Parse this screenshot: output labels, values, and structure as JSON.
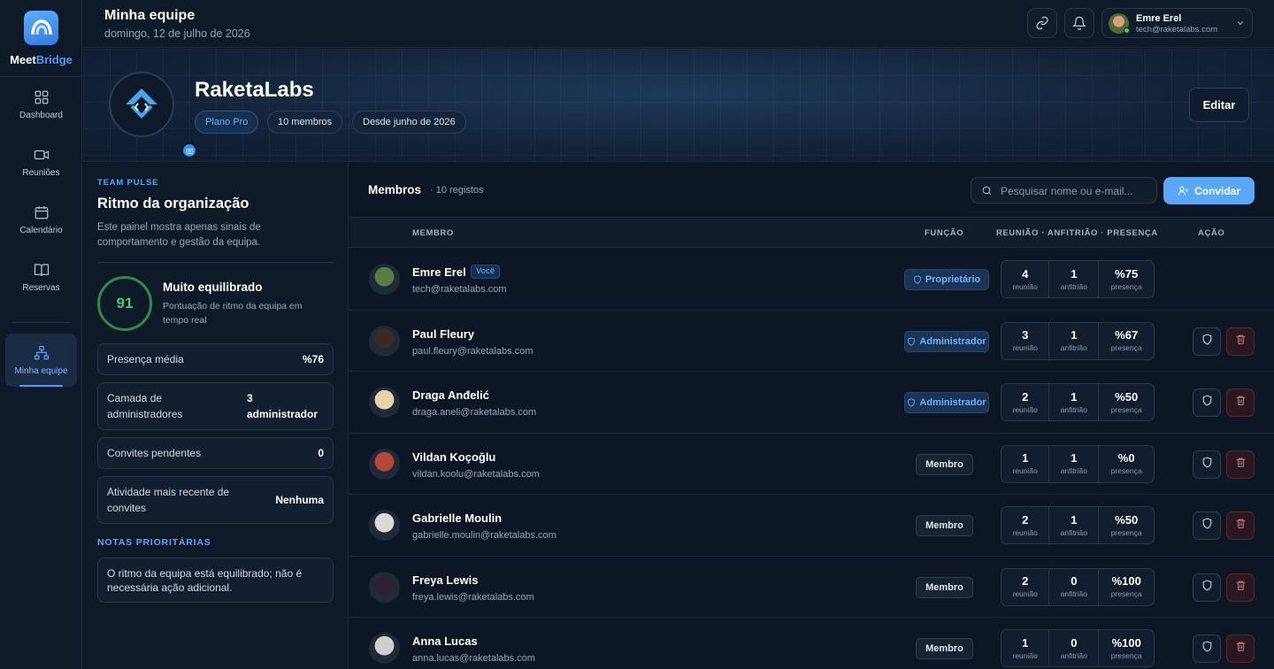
{
  "brand": {
    "part1": "Meet",
    "part2": "Bridge"
  },
  "nav": [
    {
      "label": "Dashboard",
      "icon": "grid-icon"
    },
    {
      "label": "Reuniões",
      "icon": "video-icon"
    },
    {
      "label": "Calendário",
      "icon": "calendar-icon"
    },
    {
      "label": "Reservas",
      "icon": "book-icon"
    },
    {
      "label": "Minha equipe",
      "icon": "org-chart-icon",
      "active": true
    }
  ],
  "header": {
    "title": "Minha equipe",
    "date": "domingo, 12 de julho de 2026",
    "user_name": "Emre Erel",
    "user_email": "tech@raketalabs.com"
  },
  "org": {
    "name": "RaketaLabs",
    "chips": [
      "Plano Pro",
      "10 membros",
      "Desde junho de 2026"
    ],
    "edit_label": "Editar"
  },
  "pulse": {
    "kicker": "TEAM PULSE",
    "title": "Ritmo da organização",
    "description": "Este painel mostra apenas sinais de comportamento e gestão da equipa.",
    "score": "91",
    "score_title": "Muito equilibrado",
    "score_desc": "Pontuação de ritmo da equipa em tempo real",
    "stats": [
      {
        "label": "Presença média",
        "value": "%76"
      },
      {
        "label": "Camada de administradores",
        "value": "3 administrador"
      },
      {
        "label": "Convites pendentes",
        "value": "0"
      },
      {
        "label": "Atividade mais recente de convites",
        "value": "Nenhuma"
      }
    ],
    "notes_kicker": "NOTAS PRIORITÁRIAS",
    "note": "O ritmo da equipa está equilibrado; não é necessária ação adicional."
  },
  "members": {
    "title": "Membros",
    "count": "· 10 registos",
    "search_placeholder": "Pesquisar nome ou e-mail...",
    "invite_label": "Convidar",
    "columns": {
      "member": "MEMBRO",
      "role": "FUNÇÃO",
      "stats": "REUNIÃO · ANFITRIÃO · PRESENÇA",
      "action": "AÇÃO"
    },
    "units": {
      "meetings": "reunião",
      "host": "anfitrião",
      "presence": "presença"
    },
    "you_badge": "Você",
    "rows": [
      {
        "name": "Emre Erel",
        "email": "tech@raketalabs.com",
        "role": "Proprietário",
        "role_type": "owner",
        "meetings": "4",
        "host": "1",
        "presence": "%75",
        "you": true,
        "avatar_color": "#5b7a45"
      },
      {
        "name": "Paul Fleury",
        "email": "paul.fleury@raketalabs.com",
        "role": "Administrador",
        "role_type": "admin",
        "meetings": "3",
        "host": "1",
        "presence": "%67",
        "avatar_color": "#3a2a22"
      },
      {
        "name": "Draga Anđelić",
        "email": "draga.aneli@raketalabs.com",
        "role": "Administrador",
        "role_type": "admin",
        "meetings": "2",
        "host": "1",
        "presence": "%50",
        "avatar_color": "#e8d3a8"
      },
      {
        "name": "Vildan Koçoğlu",
        "email": "vildan.koolu@raketalabs.com",
        "role": "Membro",
        "role_type": "member",
        "meetings": "1",
        "host": "1",
        "presence": "%0",
        "avatar_color": "#b5463a"
      },
      {
        "name": "Gabrielle Moulin",
        "email": "gabrielle.moulin@raketalabs.com",
        "role": "Membro",
        "role_type": "member",
        "meetings": "2",
        "host": "1",
        "presence": "%50",
        "avatar_color": "#d9d9d9"
      },
      {
        "name": "Freya Lewis",
        "email": "freya.lewis@raketalabs.com",
        "role": "Membro",
        "role_type": "member",
        "meetings": "2",
        "host": "0",
        "presence": "%100",
        "avatar_color": "#2a2230"
      },
      {
        "name": "Anna Lucas",
        "email": "anna.lucas@raketalabs.com",
        "role": "Membro",
        "role_type": "member",
        "meetings": "1",
        "host": "0",
        "presence": "%100",
        "avatar_color": "#cfcfcf"
      }
    ]
  }
}
